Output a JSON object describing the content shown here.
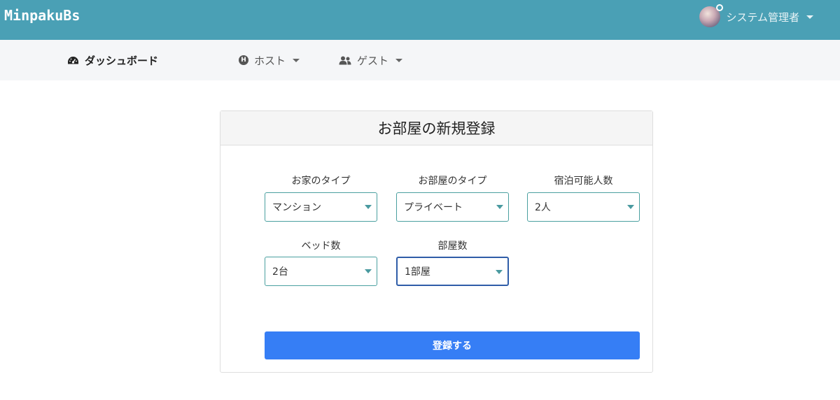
{
  "app": {
    "brand": "MinpakuBs"
  },
  "user": {
    "name": "システム管理者",
    "avatar_icon": "user-avatar"
  },
  "nav": {
    "dashboard": {
      "label": "ダッシュボード",
      "icon": "tachometer-icon"
    },
    "host": {
      "label": "ホスト",
      "icon": "h-circle-icon"
    },
    "guest": {
      "label": "ゲスト",
      "icon": "users-icon"
    }
  },
  "form": {
    "title": "お部屋の新規登録",
    "fields": {
      "house_type": {
        "label": "お家のタイプ",
        "value": "マンション"
      },
      "room_type": {
        "label": "お部屋のタイプ",
        "value": "プライベート"
      },
      "capacity": {
        "label": "宿泊可能人数",
        "value": "2人"
      },
      "beds": {
        "label": "ベッド数",
        "value": "2台"
      },
      "rooms": {
        "label": "部屋数",
        "value": "1部屋"
      }
    },
    "submit_label": "登録する"
  },
  "colors": {
    "topbar": "#4aa0b5",
    "subnav": "#f5f6f8",
    "submit": "#367ef5",
    "focus_border": "#2f5da8"
  }
}
